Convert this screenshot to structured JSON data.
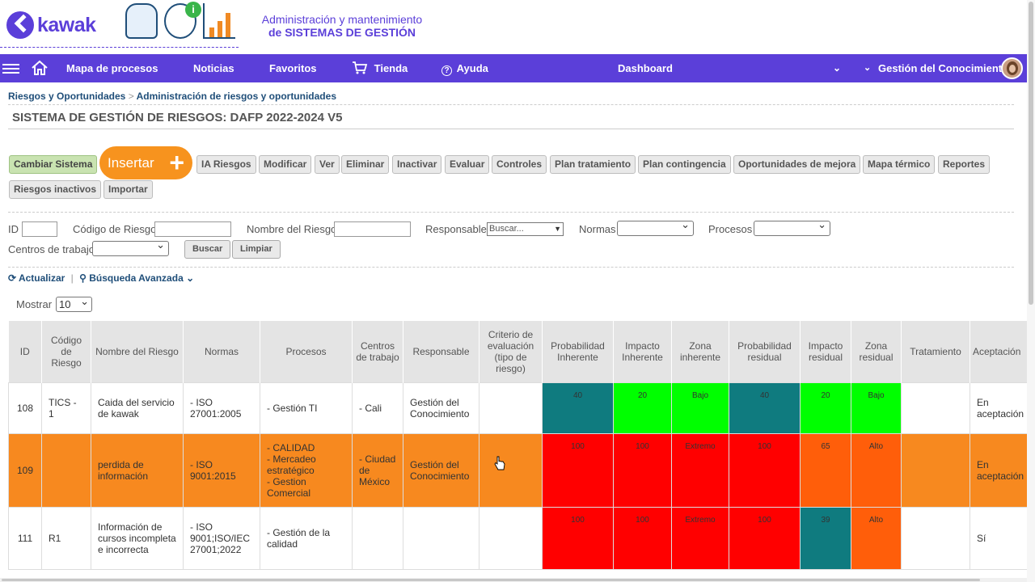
{
  "brand": {
    "name": "kawak",
    "tagline_1": "Administración y mantenimiento",
    "tagline_2": "de SISTEMAS DE GESTIÓN",
    "color": "#5b3fd9"
  },
  "nav": {
    "items": [
      "Mapa de procesos",
      "Noticias",
      "Favoritos",
      "Tienda",
      "Ayuda"
    ],
    "dashboard": "Dashboard",
    "user_area": "Gestión del Conocimiento"
  },
  "breadcrumb": {
    "parent": "Riesgos y Oportunidades",
    "separator": ">",
    "current": "Administración de riesgos y oportunidades"
  },
  "page_title": "SISTEMA DE GESTIÓN DE RIESGOS: DAFP 2022-2024 V5",
  "toolbar": {
    "change_system": "Cambiar Sistema",
    "insert": "Insertar",
    "buttons": [
      "IA Riesgos",
      "Modificar",
      "Ver",
      "Eliminar",
      "Inactivar",
      "Evaluar",
      "Controles",
      "Plan tratamiento",
      "Plan contingencia",
      "Oportunidades de mejora",
      "Mapa térmico",
      "Reportes"
    ],
    "buttons_row2": [
      "Riesgos inactivos",
      "Importar"
    ]
  },
  "filters": {
    "id_label": "ID",
    "code_label": "Código de Riesgo",
    "name_label": "Nombre del Riesgo",
    "responsible_label": "Responsable",
    "responsible_placeholder": "Buscar...",
    "norms_label": "Normas",
    "processes_label": "Procesos",
    "work_centers_label": "Centros de trabajo",
    "search_button": "Buscar",
    "clear_button": "Limpiar"
  },
  "actions": {
    "refresh": "Actualizar",
    "separator": "|",
    "advanced_search": "Búsqueda Avanzada"
  },
  "pagination": {
    "show_label": "Mostrar",
    "page_size": "10"
  },
  "table": {
    "headers": [
      "ID",
      "Código de Riesgo",
      "Nombre del Riesgo",
      "Normas",
      "Procesos",
      "Centros de trabajo",
      "Responsable",
      "Criterio de evaluación (tipo de riesgo)",
      "Probabilidad Inherente",
      "Impacto Inherente",
      "Zona inherente",
      "Probabilidad residual",
      "Impacto residual",
      "Zona residual",
      "Tratamiento",
      "Aceptación"
    ],
    "rows": [
      {
        "id": "108",
        "code": "TICS - 1",
        "name": "Caida del servicio de kawak",
        "norms": "- ISO 27001:2005",
        "processes": "- Gestión TI",
        "centers": "- Cali",
        "responsible": "Gestión del Conocimiento",
        "criteria": "",
        "prob_inh": "40",
        "imp_inh": "20",
        "zone_inh": "Bajo",
        "prob_res": "40",
        "imp_res": "20",
        "zone_res": "Bajo",
        "treatment": "",
        "acceptance": "En aceptación"
      },
      {
        "id": "109",
        "code": "",
        "name": "perdida de información",
        "norms": "- ISO 9001:2015",
        "processes": "- CALIDAD\n- Mercadeo estratégico\n- Gestion Comercial",
        "centers": "- Ciudad de México",
        "responsible": "Gestión del Conocimiento",
        "criteria": "",
        "prob_inh": "100",
        "imp_inh": "100",
        "zone_inh": "Extremo",
        "prob_res": "100",
        "imp_res": "65",
        "zone_res": "Alto",
        "treatment": "",
        "acceptance": "En aceptación"
      },
      {
        "id": "111",
        "code": "R1",
        "name": "Información de cursos incompleta e incorrecta",
        "norms": "- ISO 9001;ISO/IEC 27001;2022",
        "processes": "- Gestión de la calidad",
        "centers": "",
        "responsible": "",
        "criteria": "",
        "prob_inh": "100",
        "imp_inh": "100",
        "zone_inh": "Extremo",
        "prob_res": "100",
        "imp_res": "39",
        "zone_res": "Alto",
        "treatment": "",
        "acceptance": "Sí"
      }
    ]
  },
  "colors": {
    "nav": "#5b3fd9",
    "insert": "#f7931e",
    "highlight_row": "#f7891f",
    "teal": "#0f7b7f",
    "green": "#00ff00",
    "red": "#ff0000",
    "orange": "#ff5e0a"
  },
  "icons": [
    "menu-icon",
    "home-icon",
    "cart-icon",
    "help-icon",
    "chevron-down-icon",
    "refresh-icon",
    "search-icon",
    "plus-icon",
    "pointer-cursor-icon"
  ]
}
